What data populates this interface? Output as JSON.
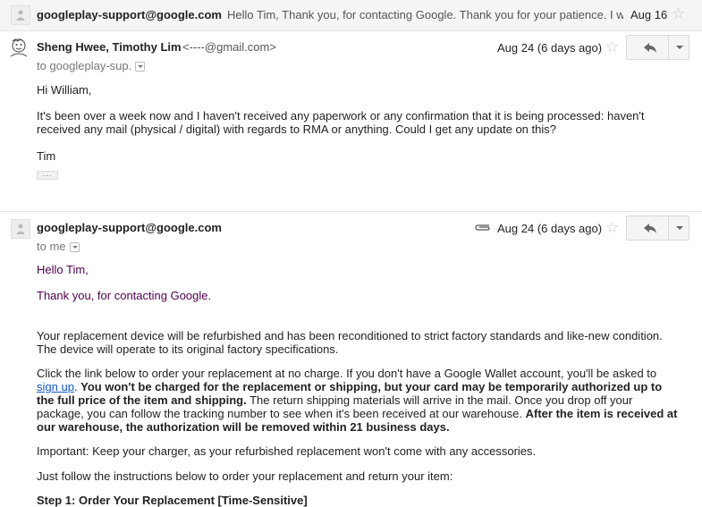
{
  "collapsed_message": {
    "sender": "googleplay-support@google.com",
    "snippet": "Hello Tim, Thank you, for contacting Google. Thank you for your patience. I w.",
    "date": "Aug 16"
  },
  "message1": {
    "sender_name": "Sheng Hwee, Timothy Lim",
    "sender_email": "<----@gmail.com>",
    "to_line": "to googleplay-sup.",
    "date": "Aug 24 (6 days ago)",
    "greeting": "Hi William,",
    "paragraph1": "It's been over a week now and I haven't received any paperwork or any confirmation that it is being processed: haven't received any mail (physical / digital) with regards to RMA or anything. Could I get any update on this?",
    "signature": "Tim",
    "ellipsis": "..."
  },
  "message2": {
    "sender": "googleplay-support@google.com",
    "to_line": "to me",
    "date": "Aug 24 (6 days ago)",
    "greeting": "Hello Tim,",
    "thanks": "Thank you, for contacting Google.",
    "p_refurb": "Your replacement device will be refurbished and has been reconditioned to strict factory standards and like-new condition. The device will operate to its original factory specifications.",
    "p_order_1": "Click the link below to order your replacement at no charge. If you don't have a Google Wallet account, you'll be asked to ",
    "p_order_link": "sign up",
    "p_order_2": ". ",
    "p_order_bold1": "You won't be charged for the replacement or shipping, but your card may be temporarily authorized up to the full price of the item and shipping.",
    "p_order_3": " The return shipping materials will arrive in the mail. Once you drop off your package, you can follow the tracking number to see when it's been received at our warehouse. ",
    "p_order_bold2": "After the item is received at our warehouse, the authorization will be removed within 21 business days.",
    "p_important": "Important: Keep your charger, as your refurbished replacement won't come with any accessories.",
    "p_instructions": "Just follow the instructions below to order your replacement and return your item:",
    "step1": "Step 1: Order Your Replacement [Time-Sensitive]"
  },
  "icons": {
    "avatar": "person-icon",
    "star": "star-icon",
    "reply": "reply-arrow-icon",
    "more": "chevron-down-icon",
    "attachment": "paperclip-icon"
  }
}
